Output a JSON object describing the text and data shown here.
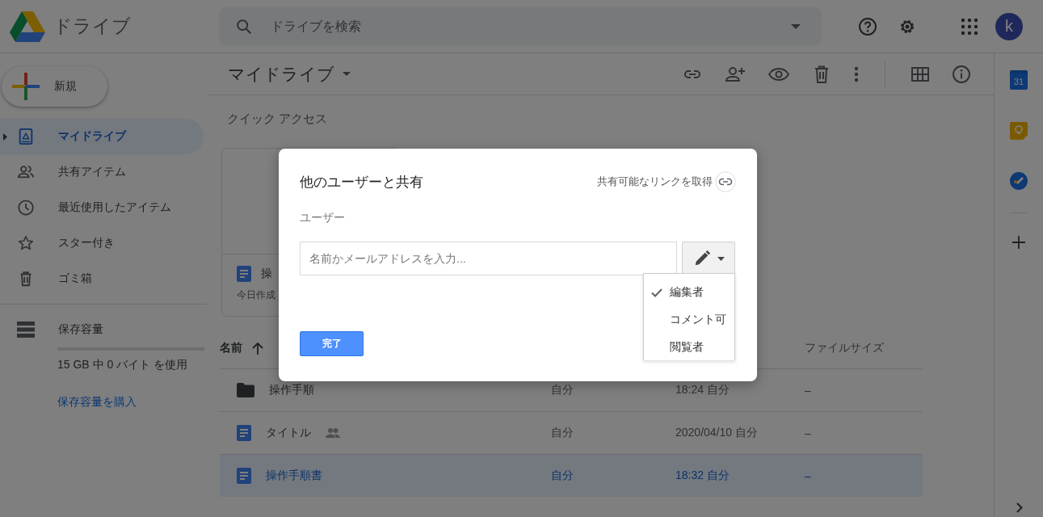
{
  "header": {
    "product_name": "ドライブ",
    "search": {
      "placeholder": "ドライブを検索"
    },
    "avatar_letter": "k"
  },
  "sidebar": {
    "new_button": "新規",
    "items": [
      {
        "kind": "drive",
        "label": "マイドライブ",
        "selected": true
      },
      {
        "kind": "shared",
        "label": "共有アイテム",
        "selected": false
      },
      {
        "kind": "recent",
        "label": "最近使用したアイテム",
        "selected": false
      },
      {
        "kind": "starred",
        "label": "スター付き",
        "selected": false
      },
      {
        "kind": "trash",
        "label": "ゴミ箱",
        "selected": false
      }
    ],
    "storage": {
      "label": "保存容量",
      "level": 0,
      "usage": "15 GB 中 0 バイト を使用",
      "buy_link": "保存容量を購入"
    }
  },
  "toolbar": {
    "title": "マイドライブ"
  },
  "quick_access": {
    "label": "クイック アクセス",
    "cards": [
      {
        "name": "操",
        "subtitle": "今日作成"
      }
    ]
  },
  "table": {
    "header": {
      "name": "名前",
      "name_sorted": true,
      "file_size": "ファイルサイズ"
    },
    "rows": [
      {
        "kind": "folder",
        "name": "操作手順",
        "shared": false,
        "owner": "自分",
        "modified": "18:24 自分",
        "size": "–",
        "selected": false
      },
      {
        "kind": "document",
        "name": "タイトル",
        "shared": true,
        "owner": "自分",
        "modified": "2020/04/10 自分",
        "size": "–",
        "selected": false
      },
      {
        "kind": "document",
        "name": "操作手順書",
        "shared": false,
        "owner": "自分",
        "modified": "18:32 自分",
        "size": "–",
        "selected": true
      }
    ]
  },
  "side_panel": {
    "calendar_date": "31"
  },
  "dialog": {
    "title": "他のユーザーと共有",
    "link_text": "共有可能なリンクを取得",
    "users_label": "ユーザー",
    "input": {
      "placeholder": "名前かメールアドレスを入力..."
    },
    "roles": [
      {
        "label": "編集者",
        "selected": true
      },
      {
        "label": "コメント可",
        "selected": false
      },
      {
        "label": "閲覧者",
        "selected": false
      }
    ],
    "done_button": "完了"
  }
}
